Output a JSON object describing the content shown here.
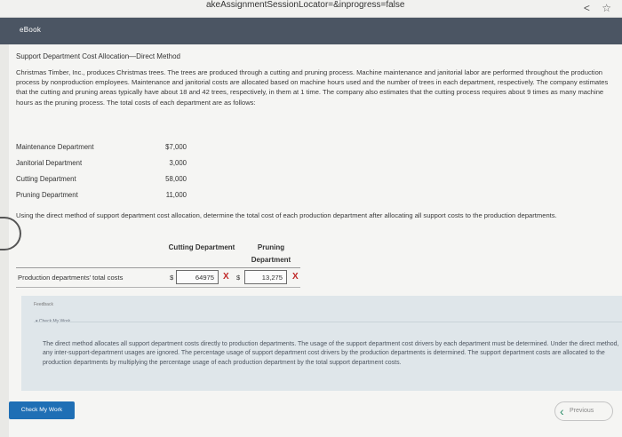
{
  "browser": {
    "url_prefix": "...invoker=&takeAssignmentSessionLocator=&inprogress=false",
    "url_shown": "akeAssignmentSessionLocator=&inprogress=false",
    "share_icon": "share-icon",
    "bookmark_icon": "star-icon"
  },
  "ebook_tab": "eBook",
  "title": "Support Department Cost Allocation—Direct Method",
  "paragraph": "Christmas Timber, Inc., produces Christmas trees. The trees are produced through a cutting and pruning process. Machine maintenance and janitorial labor are performed throughout the production process by nonproduction employees. Maintenance and janitorial costs are allocated based on machine hours used and the number of trees in each department, respectively. The company estimates that the cutting and pruning areas typically have about 18 and 42 trees, respectively, in them at 1 time. The company also estimates that the cutting process requires about 9 times as many machine hours as the pruning process. The total costs of each department are as follows:",
  "costs": [
    {
      "label": "Maintenance Department",
      "value": "$7,000"
    },
    {
      "label": "Janitorial Department",
      "value": "3,000"
    },
    {
      "label": "Cutting Department",
      "value": "58,000"
    },
    {
      "label": "Pruning Department",
      "value": "11,000"
    }
  ],
  "question": "Using the direct method of support department cost allocation, determine the total cost of each production department after allocating all support costs to the production departments.",
  "table": {
    "col_cutting": "Cutting Department",
    "col_pruning": "Pruning Department",
    "row_label": "Production departments' total costs",
    "currency": "$",
    "cutting_value": "64975",
    "pruning_value": "13,275",
    "wrong_mark": "X"
  },
  "feedback": {
    "label": "Feedback",
    "check_label": "Check My Work",
    "text": "The direct method allocates all support department costs directly to production departments. The usage of the support department cost drivers by each department must be determined. Under the direct method, any inter-support-department usages are ignored. The percentage usage of support department cost drivers by the production departments is determined. The support department costs are allocated to the production departments by multiplying the percentage usage of each production department by the total support department costs."
  },
  "buttons": {
    "check_my_work": "Check My Work",
    "previous": "Previous"
  },
  "colors": {
    "header": "#4b5563",
    "primary_button": "#1f6fb5",
    "error": "#c02828",
    "feedback_bg": "#dfe6ea"
  }
}
